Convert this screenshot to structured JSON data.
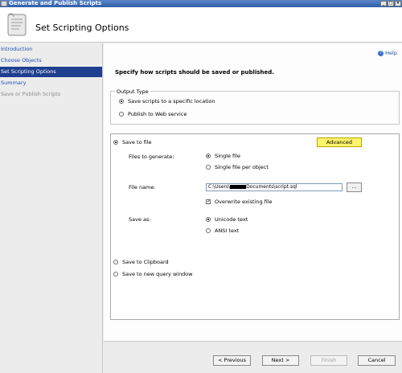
{
  "window": {
    "title": "Generate and Publish Scripts",
    "controls": [
      "_",
      "□",
      "×"
    ]
  },
  "header": {
    "title": "Set Scripting Options",
    "icon": "scroll-icon"
  },
  "sidebar": {
    "items": [
      {
        "label": "Introduction",
        "state": "link"
      },
      {
        "label": "Choose Objects",
        "state": "link"
      },
      {
        "label": "Set Scripting Options",
        "state": "active"
      },
      {
        "label": "Summary",
        "state": "link"
      },
      {
        "label": "Save or Publish Scripts",
        "state": "disabled"
      }
    ]
  },
  "main": {
    "help_label": "Help",
    "instruction": "Specify how scripts should be saved or published.",
    "output_type": {
      "legend": "Output Type",
      "options": [
        {
          "label": "Save scripts to a specific location",
          "selected": true
        },
        {
          "label": "Publish to Web service",
          "selected": false
        }
      ]
    },
    "save_panel": {
      "save_to_file": "Save to file",
      "advanced_label": "Advanced",
      "files_to_generate_label": "Files to generate:",
      "files_options": [
        {
          "label": "Single file",
          "selected": true
        },
        {
          "label": "Single file per object",
          "selected": false
        }
      ],
      "file_name_label": "File name:",
      "file_name_prefix": "C:\\Users\\",
      "file_name_suffix": "Documents\\script.sql",
      "browse_label": "...",
      "overwrite_label": "Overwrite existing file",
      "overwrite_checked": true,
      "save_as_label": "Save as:",
      "save_as_options": [
        {
          "label": "Unicode text",
          "selected": true
        },
        {
          "label": "ANSI text",
          "selected": false
        }
      ],
      "clipboard_label": "Save to Clipboard",
      "query_window_label": "Save to new query window"
    }
  },
  "footer": {
    "previous": "< Previous",
    "next": "Next >",
    "finish": "Finish",
    "cancel": "Cancel"
  },
  "colors": {
    "active_item": "#1f3f8f",
    "link": "#1c4fb5",
    "highlight": "#fff36b"
  }
}
